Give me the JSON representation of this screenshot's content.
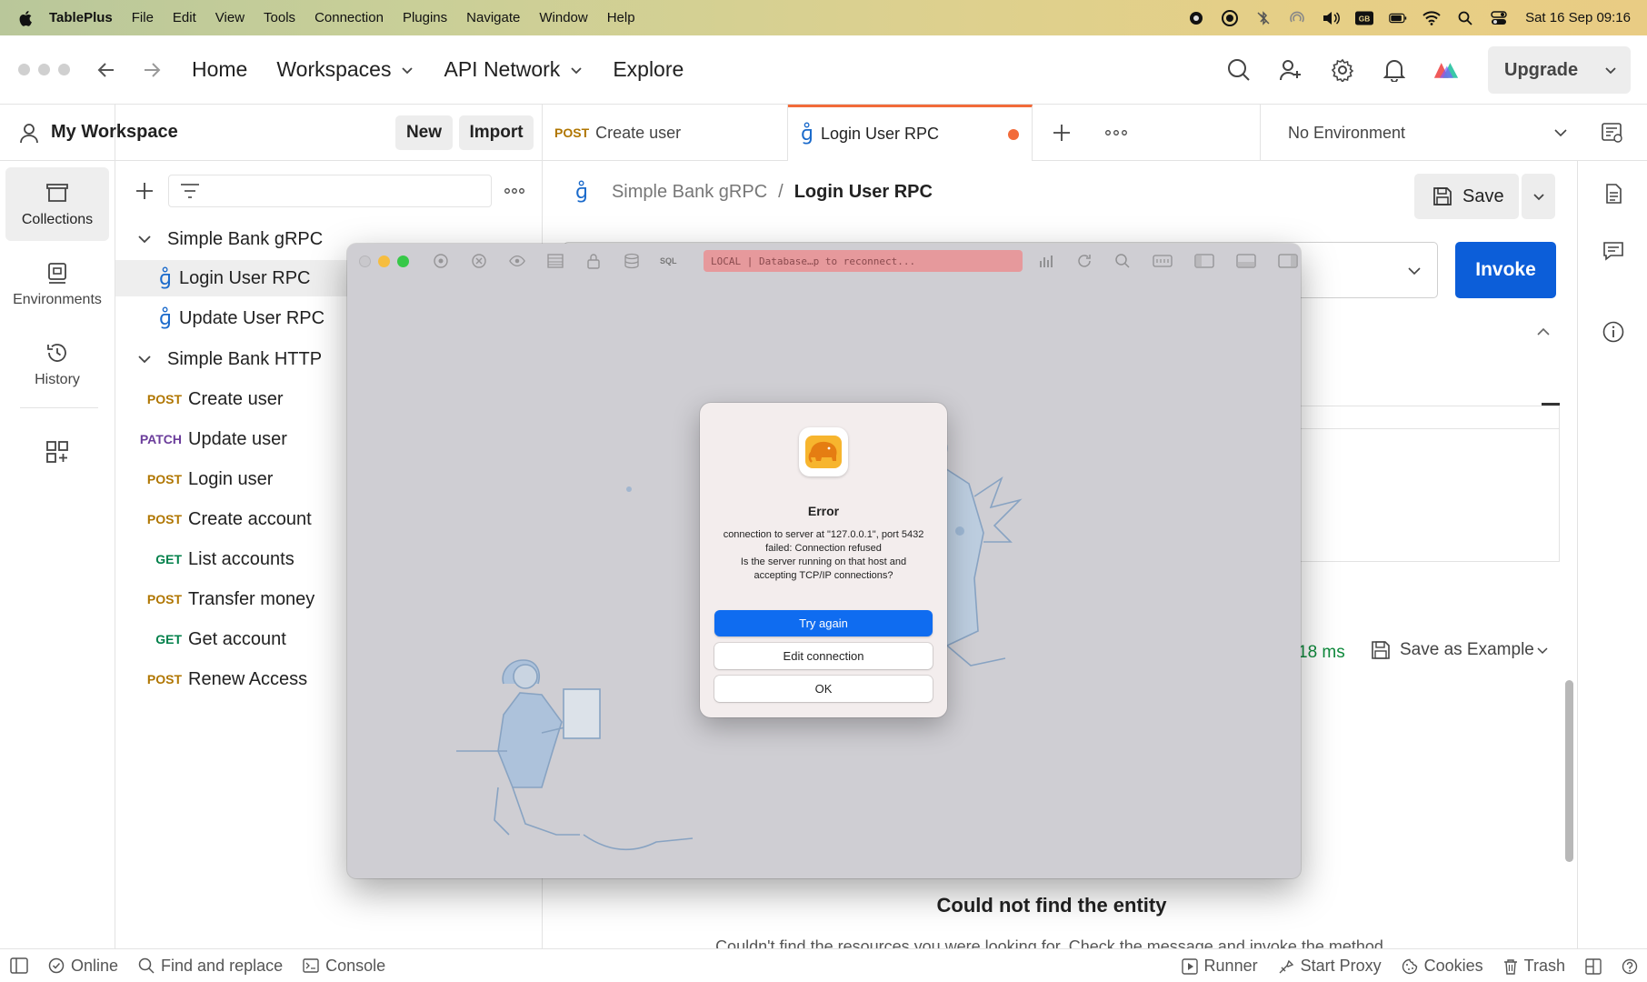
{
  "menubar": {
    "app_name": "TablePlus",
    "items": [
      "File",
      "Edit",
      "View",
      "Tools",
      "Connection",
      "Plugins",
      "Navigate",
      "Window",
      "Help"
    ],
    "clock": "Sat 16 Sep  09:16",
    "keyboard_layout": "GB"
  },
  "topbar": {
    "home": "Home",
    "workspaces": "Workspaces",
    "api_network": "API Network",
    "explore": "Explore",
    "upgrade": "Upgrade"
  },
  "rail": {
    "collections": "Collections",
    "environments": "Environments",
    "history": "History"
  },
  "sidebar": {
    "workspace_title": "My Workspace",
    "new_label": "New",
    "import_label": "Import",
    "tree": [
      {
        "type": "folder",
        "label": "Simple Bank gRPC"
      },
      {
        "type": "grpc",
        "label": "Login User RPC"
      },
      {
        "type": "grpc",
        "label": "Update User RPC"
      },
      {
        "type": "folder",
        "label": "Simple Bank HTTP"
      },
      {
        "type": "request",
        "method": "POST",
        "label": "Create user"
      },
      {
        "type": "request",
        "method": "PATCH",
        "label": "Update user"
      },
      {
        "type": "request",
        "method": "POST",
        "label": "Login user"
      },
      {
        "type": "request",
        "method": "POST",
        "label": "Create account"
      },
      {
        "type": "request",
        "method": "GET",
        "label": "List accounts"
      },
      {
        "type": "request",
        "method": "POST",
        "label": "Transfer money"
      },
      {
        "type": "request",
        "method": "GET",
        "label": "Get account"
      },
      {
        "type": "request",
        "method": "POST",
        "label": "Renew Access"
      }
    ]
  },
  "tabs": {
    "tab1_method": "POST",
    "tab1_label": "Create user",
    "tab2_label": "Login User RPC",
    "environment": "No Environment"
  },
  "request": {
    "breadcrumb_parent": "Simple Bank gRPC",
    "breadcrumb_sep": "/",
    "breadcrumb_current": "Login User RPC",
    "save_label": "Save",
    "invoke_label": "Invoke",
    "response_time": "18 ms",
    "save_as_example": "Save as Example",
    "not_found_title": "Could not find the entity",
    "not_found_desc": "Couldn't find the resources you were looking for. Check the message and invoke the method."
  },
  "statusbar": {
    "online": "Online",
    "find_replace": "Find and replace",
    "console": "Console",
    "runner": "Runner",
    "start_proxy": "Start Proxy",
    "cookies": "Cookies",
    "trash": "Trash"
  },
  "tableplus": {
    "status_text": "LOCAL | Database…p to reconnect...",
    "sql_label": "SQL",
    "dialog": {
      "title": "Error",
      "message": "connection to server at \"127.0.0.1\", port 5432 failed: Connection refused\nIs the server running on that host and accepting TCP/IP connections?",
      "try_again": "Try again",
      "edit_connection": "Edit connection",
      "ok": "OK"
    }
  },
  "colors": {
    "accent_orange": "#f26b3a",
    "invoke_blue": "#0c5ed9",
    "dialog_primary": "#0f6cf0",
    "post": "#b07600",
    "patch": "#6b3d9b",
    "get": "#00804a"
  }
}
